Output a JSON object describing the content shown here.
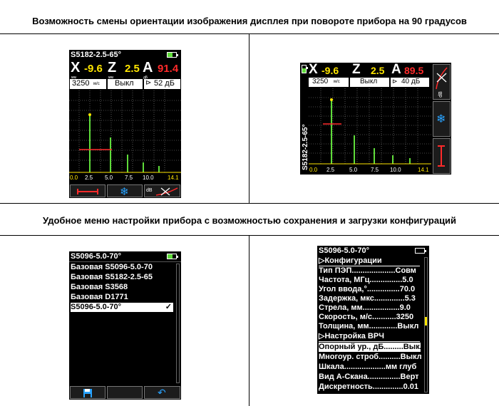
{
  "headings": {
    "top": "Возможность смены ориентации изображения дисплея при повороте прибора на 90 градусов",
    "middle": "Удобное меню настройки прибора с возможностью сохранения и загрузки конфигураций"
  },
  "portrait_scan": {
    "probe": "S5182-2.5-65°",
    "x_label": "X",
    "x_unit": "мм",
    "x_value": "-9.6",
    "z_label": "Z",
    "z_unit": "мм",
    "z_value": "2.5",
    "a_label": "A",
    "a_unit": "дБ",
    "a_value": "91.4",
    "speed_value": "3250",
    "speed_unit": "м/с",
    "mode": "Выкл",
    "gain": "52 дБ",
    "scale_ticks": [
      "0.0",
      "2.5",
      "5.0",
      "7.5",
      "10.0",
      "14.1"
    ],
    "buttons": [
      "gate-icon",
      "freeze-icon",
      "tvg-icon"
    ],
    "db_label": "dB"
  },
  "landscape_scan": {
    "probe": "S5182-2.5-65°",
    "x_label": "X",
    "x_value": "-9.6",
    "z_label": "Z",
    "z_value": "2.5",
    "a_label": "A",
    "a_value": "89.5",
    "speed_value": "3250",
    "speed_unit": "м/с",
    "mode": "Выкл",
    "gain": "40 дБ",
    "scale_ticks": [
      "0.0",
      "2.5",
      "5.0",
      "7.5",
      "10.0",
      "14.1"
    ],
    "db_label": "dB"
  },
  "config_list": {
    "title": "S5096-5.0-70°",
    "items": [
      {
        "label": "Базовая S5096-5.0-70",
        "selected": false
      },
      {
        "label": "Базовая S5182-2.5-65",
        "selected": false
      },
      {
        "label": "Базовая S3568",
        "selected": false
      },
      {
        "label": "Базовая D1771",
        "selected": false
      },
      {
        "label": "S5096-5.0-70°",
        "selected": true
      }
    ],
    "check_mark": "✓"
  },
  "settings_menu": {
    "title": "S5096-5.0-70°",
    "section_1": "Конфигурации",
    "rows_1": [
      "Тип ПЭП....................Совм",
      "Частота, МГц...............5.0",
      "Угол ввода,°...............70.0",
      "Задержка, мкс..............5.3",
      "Стрела, мм.................9.0",
      "Скорость, м/с...........3250",
      "Толщина, мм.............Выкл"
    ],
    "section_2": "Настройка ВРЧ",
    "rows_2": [
      "Опорный ур., дБ.........Выкл",
      "Многоур. строб..........Выкл",
      "Шкала...................мм глуб",
      "Вид А-Скана...............Верт",
      "Дискретность..............0.01"
    ],
    "selected_row": "Опорный ур., дБ.........Выкл"
  },
  "colors": {
    "accent_yellow": "#ffe600",
    "accent_red": "#ff2a2a",
    "signal_green": "#5fdc3a",
    "freeze_blue": "#29a3ff"
  }
}
